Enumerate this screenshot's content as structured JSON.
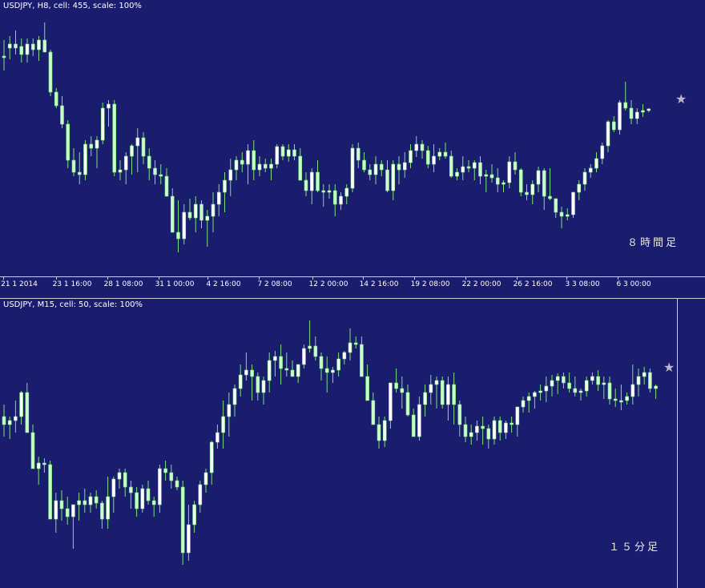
{
  "top": {
    "title": "USDJPY, H8, cell: 455, scale: 100%",
    "timeframe_label": "８時間足",
    "xaxis_labels": [
      "21 1 2014",
      "23 1 16:00",
      "28 1 08:00",
      "31 1 00:00",
      "4 2 16:00",
      "7 2 08:00",
      "12 2 00:00",
      "14 2 16:00",
      "19 2 08:00",
      "22 2 00:00",
      "26 2 16:00",
      "3 3 08:00",
      "6 3 00:00"
    ]
  },
  "bottom": {
    "title": "USDJPY, M15, cell: 50, scale: 100%",
    "timeframe_label": "１５分足"
  },
  "colors": {
    "background": "#1a1c6e",
    "bull_candle": "#ffffff",
    "bear_candle": "#c8ffc8",
    "wick": "#7ee07e",
    "star": "#b8b8c8"
  },
  "icons": {
    "marker": "star-icon"
  },
  "chart_data": [
    {
      "type": "candlestick",
      "title": "USDJPY, H8, cell: 455, scale: 100%",
      "x_tick_labels": [
        "21 1 2014",
        "23 1 16:00",
        "28 1 08:00",
        "31 1 00:00",
        "4 2 16:00",
        "7 2 08:00",
        "12 2 00:00",
        "14 2 16:00",
        "19 2 08:00",
        "22 2 00:00",
        "26 2 16:00",
        "3 3 08:00",
        "6 3 00:00"
      ],
      "annotation": "８時間足",
      "candles": [
        [
          70,
          50,
          88,
          72
        ],
        [
          60,
          45,
          74,
          55
        ],
        [
          55,
          38,
          68,
          60
        ],
        [
          58,
          48,
          78,
          68
        ],
        [
          68,
          48,
          78,
          55
        ],
        [
          55,
          48,
          70,
          62
        ],
        [
          62,
          45,
          76,
          50
        ],
        [
          50,
          28,
          62,
          65
        ],
        [
          65,
          62,
          120,
          115
        ],
        [
          115,
          110,
          135,
          132
        ],
        [
          132,
          120,
          160,
          155
        ],
        [
          155,
          150,
          210,
          200
        ],
        [
          200,
          185,
          220,
          215
        ],
        [
          215,
          190,
          230,
          218
        ],
        [
          218,
          175,
          225,
          180
        ],
        [
          180,
          170,
          195,
          185
        ],
        [
          185,
          170,
          210,
          175
        ],
        [
          175,
          128,
          180,
          135
        ],
        [
          135,
          125,
          158,
          130
        ],
        [
          130,
          125,
          220,
          215
        ],
        [
          215,
          200,
          225,
          212
        ],
        [
          212,
          190,
          230,
          195
        ],
        [
          195,
          180,
          218,
          182
        ],
        [
          182,
          160,
          215,
          172
        ],
        [
          172,
          165,
          205,
          195
        ],
        [
          195,
          185,
          225,
          210
        ],
        [
          210,
          200,
          230,
          218
        ],
        [
          218,
          205,
          230,
          220
        ],
        [
          220,
          210,
          245,
          245
        ],
        [
          245,
          235,
          290,
          290
        ],
        [
          290,
          250,
          315,
          298
        ],
        [
          298,
          255,
          305,
          265
        ],
        [
          265,
          248,
          275,
          272
        ],
        [
          272,
          245,
          290,
          255
        ],
        [
          255,
          250,
          285,
          275
        ],
        [
          275,
          262,
          308,
          270
        ],
        [
          270,
          240,
          290,
          255
        ],
        [
          255,
          230,
          270,
          240
        ],
        [
          240,
          215,
          265,
          225
        ],
        [
          225,
          198,
          245,
          212
        ],
        [
          212,
          195,
          225,
          200
        ],
        [
          200,
          190,
          215,
          205
        ],
        [
          205,
          180,
          230,
          188
        ],
        [
          188,
          175,
          225,
          212
        ],
        [
          212,
          195,
          220,
          205
        ],
        [
          205,
          198,
          215,
          210
        ],
        [
          210,
          198,
          225,
          205
        ],
        [
          205,
          180,
          210,
          183
        ],
        [
          183,
          180,
          200,
          195
        ],
        [
          195,
          180,
          202,
          187
        ],
        [
          187,
          180,
          200,
          195
        ],
        [
          195,
          185,
          215,
          225
        ],
        [
          225,
          215,
          245,
          238
        ],
        [
          238,
          210,
          255,
          215
        ],
        [
          215,
          200,
          240,
          238
        ],
        [
          238,
          230,
          258,
          240
        ],
        [
          240,
          230,
          248,
          238
        ],
        [
          238,
          230,
          270,
          255
        ],
        [
          255,
          240,
          262,
          245
        ],
        [
          245,
          230,
          255,
          235
        ],
        [
          235,
          180,
          240,
          185
        ],
        [
          185,
          178,
          210,
          200
        ],
        [
          200,
          190,
          215,
          212
        ],
        [
          212,
          205,
          225,
          218
        ],
        [
          218,
          195,
          230,
          205
        ],
        [
          205,
          200,
          220,
          212
        ],
        [
          212,
          200,
          240,
          238
        ],
        [
          238,
          200,
          250,
          205
        ],
        [
          205,
          195,
          230,
          212
        ],
        [
          212,
          190,
          222,
          203
        ],
        [
          203,
          180,
          210,
          188
        ],
        [
          188,
          170,
          196,
          180
        ],
        [
          180,
          175,
          198,
          188
        ],
        [
          188,
          182,
          210,
          205
        ],
        [
          205,
          180,
          215,
          195
        ],
        [
          195,
          185,
          200,
          190
        ],
        [
          190,
          178,
          198,
          195
        ],
        [
          195,
          188,
          222,
          220
        ],
        [
          220,
          210,
          225,
          215
        ],
        [
          215,
          195,
          225,
          208
        ],
        [
          208,
          200,
          215,
          210
        ],
        [
          210,
          200,
          225,
          203
        ],
        [
          203,
          195,
          230,
          220
        ],
        [
          220,
          212,
          240,
          218
        ],
        [
          218,
          205,
          228,
          222
        ],
        [
          222,
          210,
          240,
          230
        ],
        [
          230,
          225,
          240,
          228
        ],
        [
          228,
          195,
          235,
          202
        ],
        [
          202,
          190,
          218,
          212
        ],
        [
          212,
          210,
          245,
          240
        ],
        [
          240,
          230,
          250,
          243
        ],
        [
          243,
          225,
          255,
          230
        ],
        [
          230,
          208,
          240,
          213
        ],
        [
          213,
          210,
          262,
          245
        ],
        [
          245,
          210,
          250,
          248
        ],
        [
          248,
          262,
          272,
          265
        ],
        [
          265,
          258,
          285,
          270
        ],
        [
          270,
          260,
          275,
          268
        ],
        [
          268,
          240,
          272,
          240
        ],
        [
          240,
          225,
          250,
          230
        ],
        [
          230,
          210,
          238,
          215
        ],
        [
          215,
          205,
          222,
          210
        ],
        [
          210,
          190,
          215,
          198
        ],
        [
          198,
          178,
          205,
          182
        ],
        [
          182,
          150,
          190,
          152
        ],
        [
          152,
          145,
          165,
          162
        ],
        [
          162,
          125,
          168,
          128
        ],
        [
          128,
          102,
          138,
          135
        ],
        [
          135,
          125,
          155,
          148
        ],
        [
          148,
          135,
          155,
          140
        ],
        [
          140,
          130,
          146,
          138
        ],
        [
          138,
          135,
          140,
          136
        ]
      ]
    },
    {
      "type": "candlestick",
      "title": "USDJPY, M15, cell: 50, scale: 100%",
      "annotation": "１５分足",
      "candles": [
        [
          520,
          505,
          545,
          530
        ],
        [
          530,
          520,
          548,
          525
        ],
        [
          525,
          500,
          540,
          520
        ],
        [
          520,
          488,
          530,
          490
        ],
        [
          490,
          478,
          540,
          540
        ],
        [
          540,
          530,
          560,
          585
        ],
        [
          585,
          570,
          605,
          578
        ],
        [
          578,
          572,
          590,
          580
        ],
        [
          580,
          575,
          620,
          648
        ],
        [
          648,
          615,
          665,
          625
        ],
        [
          625,
          612,
          650,
          635
        ],
        [
          635,
          620,
          655,
          645
        ],
        [
          645,
          630,
          685,
          630
        ],
        [
          630,
          615,
          650,
          625
        ],
        [
          625,
          610,
          640,
          630
        ],
        [
          630,
          615,
          640,
          620
        ],
        [
          620,
          612,
          635,
          628
        ],
        [
          628,
          625,
          660,
          648
        ],
        [
          648,
          595,
          660,
          620
        ],
        [
          620,
          595,
          640,
          598
        ],
        [
          598,
          585,
          610,
          590
        ],
        [
          590,
          585,
          620,
          608
        ],
        [
          608,
          600,
          635,
          615
        ],
        [
          615,
          608,
          645,
          635
        ],
        [
          635,
          605,
          640,
          610
        ],
        [
          610,
          600,
          630,
          625
        ],
        [
          625,
          620,
          645,
          630
        ],
        [
          630,
          580,
          640,
          585
        ],
        [
          585,
          575,
          600,
          590
        ],
        [
          590,
          580,
          610,
          600
        ],
        [
          600,
          595,
          612,
          608
        ],
        [
          608,
          600,
          705,
          690
        ],
        [
          690,
          630,
          700,
          655
        ],
        [
          655,
          625,
          665,
          630
        ],
        [
          630,
          600,
          640,
          605
        ],
        [
          605,
          585,
          615,
          590
        ],
        [
          590,
          550,
          605,
          552
        ],
        [
          552,
          530,
          560,
          540
        ],
        [
          540,
          500,
          560,
          520
        ],
        [
          520,
          490,
          545,
          505
        ],
        [
          505,
          480,
          520,
          485
        ],
        [
          485,
          455,
          495,
          468
        ],
        [
          468,
          440,
          475,
          462
        ],
        [
          462,
          455,
          500,
          470
        ],
        [
          470,
          465,
          500,
          490
        ],
        [
          490,
          470,
          505,
          475
        ],
        [
          475,
          440,
          490,
          450
        ],
        [
          450,
          438,
          470,
          445
        ],
        [
          445,
          430,
          480,
          460
        ],
        [
          460,
          440,
          470,
          462
        ],
        [
          462,
          450,
          470,
          470
        ],
        [
          470,
          455,
          478,
          455
        ],
        [
          455,
          430,
          460,
          435
        ],
        [
          435,
          400,
          440,
          432
        ],
        [
          432,
          420,
          450,
          445
        ],
        [
          445,
          440,
          475,
          460
        ],
        [
          460,
          445,
          490,
          465
        ],
        [
          465,
          458,
          478,
          462
        ],
        [
          462,
          440,
          470,
          448
        ],
        [
          448,
          438,
          455,
          440
        ],
        [
          440,
          410,
          450,
          428
        ],
        [
          428,
          420,
          435,
          430
        ],
        [
          430,
          420,
          440,
          470
        ],
        [
          470,
          455,
          500,
          500
        ],
        [
          500,
          490,
          525,
          530
        ],
        [
          530,
          520,
          560,
          550
        ],
        [
          550,
          520,
          558,
          525
        ],
        [
          525,
          480,
          535,
          478
        ],
        [
          478,
          460,
          490,
          485
        ],
        [
          485,
          470,
          510,
          490
        ],
        [
          490,
          480,
          520,
          518
        ],
        [
          518,
          510,
          545,
          545
        ],
        [
          545,
          495,
          550,
          505
        ],
        [
          505,
          480,
          520,
          490
        ],
        [
          490,
          468,
          505,
          480
        ],
        [
          480,
          470,
          510,
          475
        ],
        [
          475,
          470,
          510,
          505
        ],
        [
          505,
          470,
          525,
          480
        ],
        [
          480,
          465,
          530,
          505
        ],
        [
          505,
          500,
          545,
          530
        ],
        [
          530,
          520,
          552,
          545
        ],
        [
          545,
          530,
          555,
          540
        ],
        [
          540,
          525,
          550,
          532
        ],
        [
          532,
          520,
          555,
          535
        ],
        [
          535,
          530,
          560,
          548
        ],
        [
          548,
          520,
          555,
          525
        ],
        [
          525,
          520,
          550,
          540
        ],
        [
          540,
          525,
          548,
          528
        ],
        [
          528,
          520,
          540,
          530
        ],
        [
          530,
          515,
          545,
          508
        ],
        [
          508,
          495,
          515,
          500
        ],
        [
          500,
          490,
          515,
          495
        ],
        [
          495,
          488,
          510,
          490
        ],
        [
          490,
          480,
          500,
          488
        ],
        [
          488,
          470,
          502,
          482
        ],
        [
          482,
          468,
          495,
          475
        ],
        [
          475,
          466,
          492,
          470
        ],
        [
          470,
          465,
          485,
          478
        ],
        [
          478,
          465,
          490,
          485
        ],
        [
          485,
          470,
          495,
          490
        ],
        [
          490,
          485,
          500,
          488
        ],
        [
          488,
          470,
          495,
          475
        ],
        [
          475,
          465,
          480,
          470
        ],
        [
          470,
          462,
          488,
          480
        ],
        [
          480,
          470,
          498,
          478
        ],
        [
          478,
          470,
          505,
          498
        ],
        [
          498,
          485,
          508,
          500
        ],
        [
          500,
          480,
          512,
          500
        ],
        [
          500,
          490,
          505,
          495
        ],
        [
          495,
          455,
          505,
          480
        ],
        [
          480,
          460,
          495,
          470
        ],
        [
          470,
          458,
          480,
          465
        ],
        [
          465,
          460,
          490,
          485
        ],
        [
          485,
          480,
          498,
          482
        ]
      ]
    }
  ]
}
